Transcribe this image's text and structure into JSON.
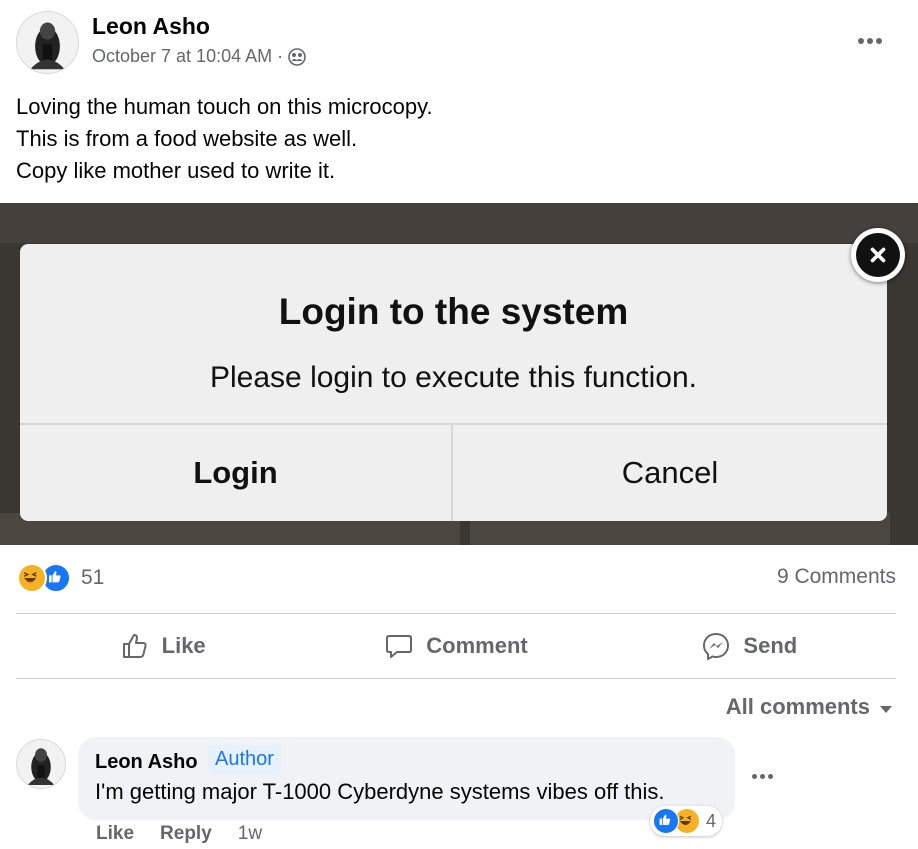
{
  "post": {
    "author": "Leon Asho",
    "timestamp": "October 7 at 10:04 AM",
    "separator": "·",
    "audience_icon": "friends-icon",
    "text_lines": [
      "Loving the human touch on this microcopy.",
      "This is from a food website as well.",
      "Copy like mother used to write it."
    ]
  },
  "image": {
    "modal_title": "Login to the system",
    "modal_message": "Please login to execute this function.",
    "login_label": "Login",
    "cancel_label": "Cancel"
  },
  "stats": {
    "reaction_icons": [
      "haha-icon",
      "like-icon"
    ],
    "reaction_count": "51",
    "comments_count": "9 Comments"
  },
  "actions": {
    "like": "Like",
    "comment": "Comment",
    "send": "Send"
  },
  "comments_filter": "All comments",
  "comment": {
    "author": "Leon Asho",
    "badge": "Author",
    "text": "I'm getting major T-1000 Cyberdyne systems vibes off this.",
    "reaction_count": "4",
    "like_label": "Like",
    "reply_label": "Reply",
    "age": "1w"
  },
  "colors": {
    "like_blue": "#1877f2",
    "haha_yellow": "#f7b125",
    "secondary_text": "#65676b"
  }
}
